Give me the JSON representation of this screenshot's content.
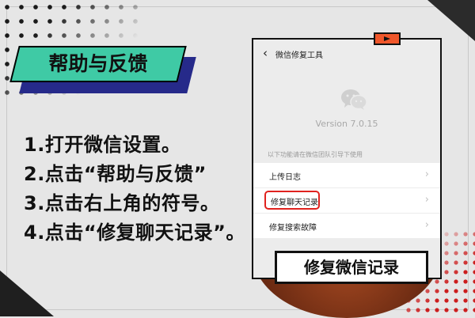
{
  "banner": {
    "title": "帮助与反馈"
  },
  "steps": [
    "1.打开微信设置。",
    "2.点击“帮助与反馈”",
    "3.点击右上角的符号。",
    "4.点击“修复聊天记录”。"
  ],
  "phone": {
    "nav_title": "微信修复工具",
    "back_icon": "chevron-left-icon",
    "logo_icon": "wechat-logo-icon",
    "version": "Version 7.0.15",
    "hint": "以下功能请在微信团队引导下使用",
    "menu": [
      {
        "label": "上传日志",
        "highlighted": false
      },
      {
        "label": "修复聊天记录",
        "highlighted": true
      },
      {
        "label": "修复搜索故障",
        "highlighted": false
      }
    ]
  },
  "caption": "修复微信记录",
  "colors": {
    "banner": "#3fcaa5",
    "banner_shadow": "#262a8a",
    "highlight": "#e0221e",
    "badge": "#f0572b"
  }
}
